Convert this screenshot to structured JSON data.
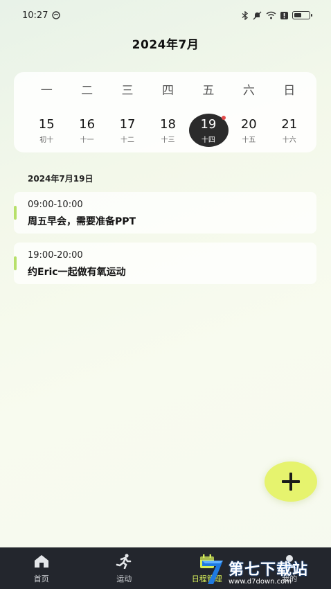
{
  "status": {
    "time": "10:27"
  },
  "header": {
    "month": "2024年7月"
  },
  "week": {
    "weekdays": [
      "一",
      "二",
      "三",
      "四",
      "五",
      "六",
      "日"
    ],
    "days": [
      {
        "num": "15",
        "lunar": "初十"
      },
      {
        "num": "16",
        "lunar": "十一"
      },
      {
        "num": "17",
        "lunar": "十二"
      },
      {
        "num": "18",
        "lunar": "十三"
      },
      {
        "num": "19",
        "lunar": "十四"
      },
      {
        "num": "20",
        "lunar": "十五"
      },
      {
        "num": "21",
        "lunar": "十六"
      }
    ]
  },
  "selected_date": "2024年7月19日",
  "events": [
    {
      "time": "09:00-10:00",
      "title": "周五早会，需要准备PPT"
    },
    {
      "time": "19:00-20:00",
      "title": "约Eric一起做有氧运动"
    }
  ],
  "tabs": [
    {
      "label": "首页"
    },
    {
      "label": "运动"
    },
    {
      "label": "日程管理"
    },
    {
      "label": "我的"
    }
  ],
  "watermark": {
    "main": "第七下载站",
    "sub": "www.d7down.com"
  },
  "colors": {
    "accent": "#d6ee5a",
    "fab": "#e6f36e",
    "event_bar": "#b7e06a",
    "tabbar": "#23262d"
  }
}
